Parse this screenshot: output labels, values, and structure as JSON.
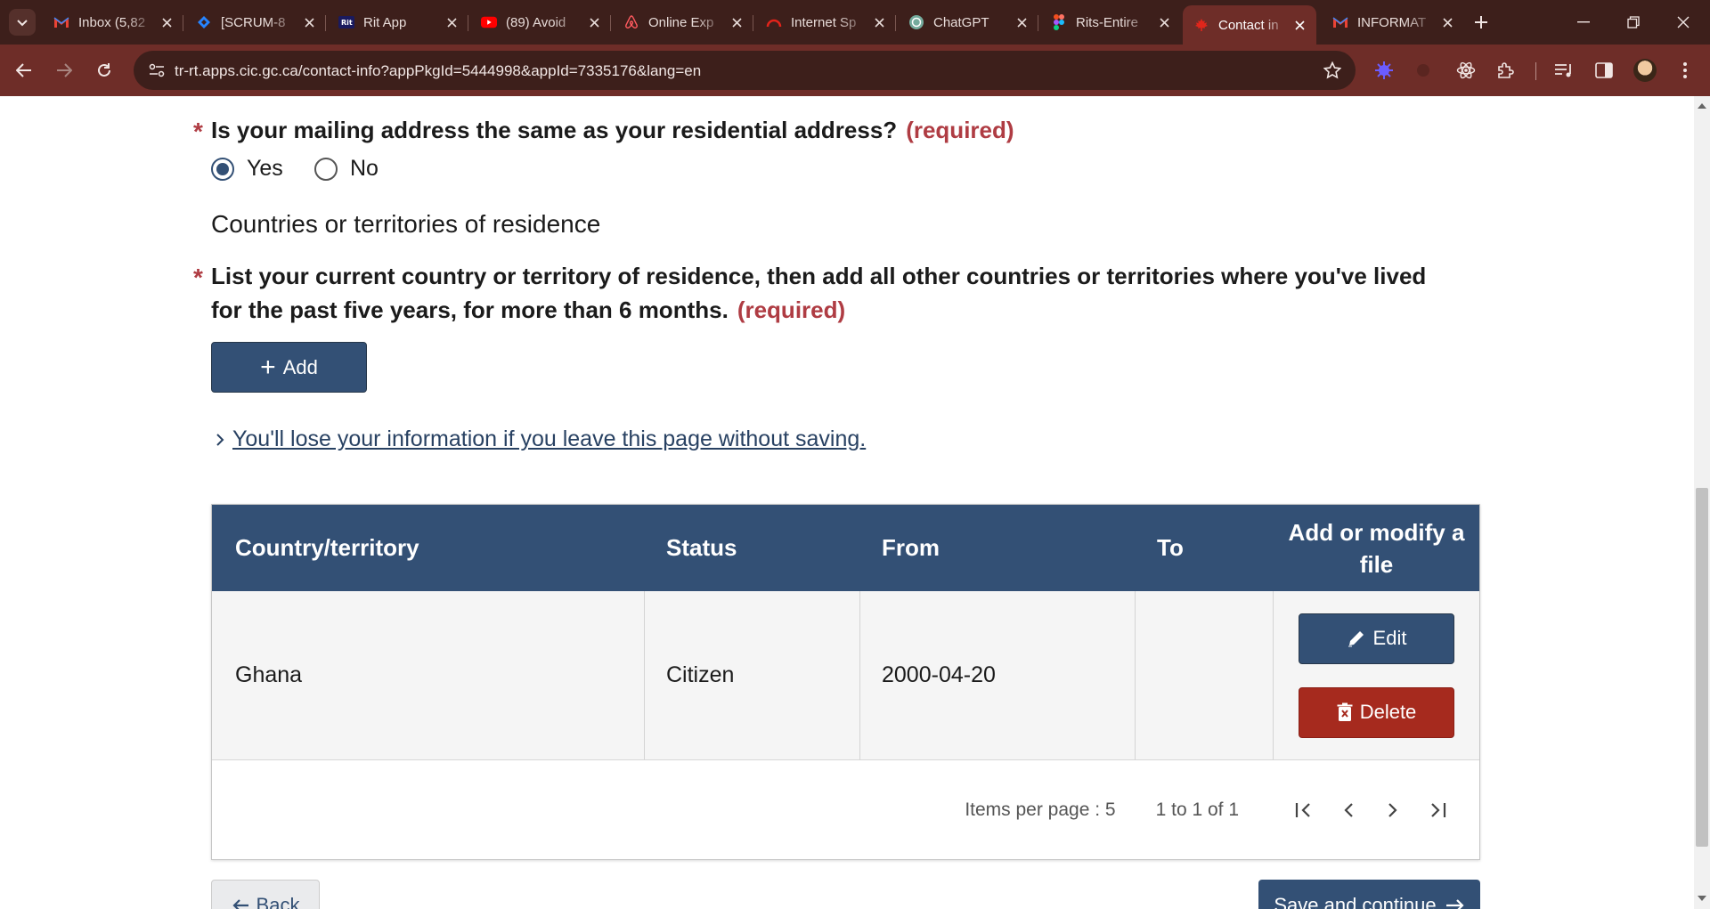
{
  "browser": {
    "tabs": [
      {
        "title": "Inbox (5,82",
        "icon": "gmail-icon"
      },
      {
        "title": "[SCRUM-8",
        "icon": "jira-icon"
      },
      {
        "title": "Rit App",
        "icon": "rit-icon"
      },
      {
        "title": "(89) Avoid",
        "icon": "youtube-icon"
      },
      {
        "title": "Online Exp",
        "icon": "airbnb-icon"
      },
      {
        "title": "Internet Sp",
        "icon": "speedtest-icon"
      },
      {
        "title": "ChatGPT",
        "icon": "chatgpt-icon"
      },
      {
        "title": "Rits-Entire",
        "icon": "figma-icon"
      },
      {
        "title": "Contact in",
        "icon": "canada-flag-icon"
      },
      {
        "title": "INFORMAT",
        "icon": "gmail-icon"
      }
    ],
    "active_tab_index": 8,
    "url": "tr-rt.apps.cic.gc.ca/contact-info?appPkgId=5444998&appId=7335176&lang=en",
    "theme": {
      "frame": "#3d1f1b",
      "toolbar": "#6e2d28"
    }
  },
  "page": {
    "mailing_question": "Is your mailing address the same as your residential address?",
    "required_label": "(required)",
    "radio_yes": "Yes",
    "radio_no": "No",
    "selected": "Yes",
    "section_heading": "Countries or territories of residence",
    "residence_question_line1": "List your current country or territory of residence, then add all other countries or territories where you've lived",
    "residence_question_line2": "for the past five years, for more than 6 months.",
    "add_button": "Add",
    "details_link": "You'll lose your information if you leave this page without saving.",
    "table": {
      "headers": [
        "Country/territory",
        "Status",
        "From",
        "To",
        "Add or modify a file"
      ],
      "rows": [
        {
          "country": "Ghana",
          "status": "Citizen",
          "from": "2000-04-20",
          "to": ""
        }
      ],
      "edit_label": "Edit",
      "delete_label": "Delete",
      "items_per_page_label": "Items per page :",
      "items_per_page_value": "5",
      "range_label": "1 to 1 of 1"
    },
    "back_button": "Back",
    "save_button": "Save and continue",
    "colors": {
      "primary": "#335075",
      "danger": "#a62a1e",
      "required": "#af3c43",
      "link": "#284162"
    }
  }
}
